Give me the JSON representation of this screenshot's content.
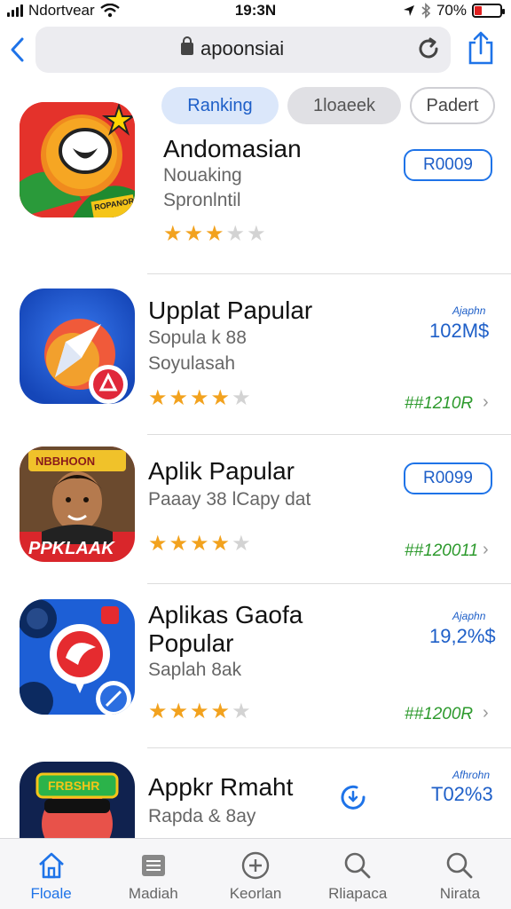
{
  "status_bar": {
    "carrier": "Ndortvear",
    "time": "19:3N",
    "battery": "70%",
    "battery_level": 0.3
  },
  "browser": {
    "url": "apoonsiai",
    "icons": [
      "back-chevron-icon",
      "lock-icon",
      "reload-icon",
      "share-icon"
    ]
  },
  "filters": [
    {
      "label": "Ranking",
      "selected": true
    },
    {
      "label": "1loaeek",
      "selected": false
    },
    {
      "label": "Padert",
      "selected": false
    }
  ],
  "apps": [
    {
      "title": "Andomasian",
      "subtitle": "Nouaking",
      "subtitle2": "Spronlntil",
      "rating": 3,
      "button": "R0009",
      "icon_badge": "ROPANOR"
    },
    {
      "title": "Upplat Papular",
      "subtitle": "Sopula k  88",
      "subtitle2": "Soyulasah",
      "rating": 4,
      "tiny": "Ajaphn",
      "price": "102M$",
      "green": "##1210R"
    },
    {
      "title": "Aplik Papular",
      "subtitle": "Paaay 38 lCapy dat",
      "rating": 4,
      "button": "R0099",
      "green": "##120011",
      "icon_top": "NBBHOON",
      "icon_bottom": "PPKLAAK"
    },
    {
      "title": "Aplikas Gaofa",
      "title2": "Popular",
      "subtitle": "Saplah 8ak",
      "rating": 4,
      "tiny": "Ajaphn",
      "price": "19,2%$",
      "green": "##1200R"
    },
    {
      "title": "Appkr Rmaht",
      "subtitle": "Rapda & 8ay",
      "tiny": "Afhrohn",
      "price": "T02%3",
      "icon_badge": "FRBSHR"
    }
  ],
  "tabs": [
    {
      "label": "Floale",
      "icon": "home-icon",
      "active": true
    },
    {
      "label": "Madiah",
      "icon": "list-icon",
      "active": false
    },
    {
      "label": "Keorlan",
      "icon": "plus-circle-icon",
      "active": false
    },
    {
      "label": "Rliapaca",
      "icon": "search-icon",
      "active": false
    },
    {
      "label": "Nirata",
      "icon": "search-icon",
      "active": false
    }
  ],
  "colors": {
    "accent": "#1e73e8",
    "star": "#f2a21e",
    "green_text": "#2d9a2d",
    "battery": "#e02020"
  }
}
